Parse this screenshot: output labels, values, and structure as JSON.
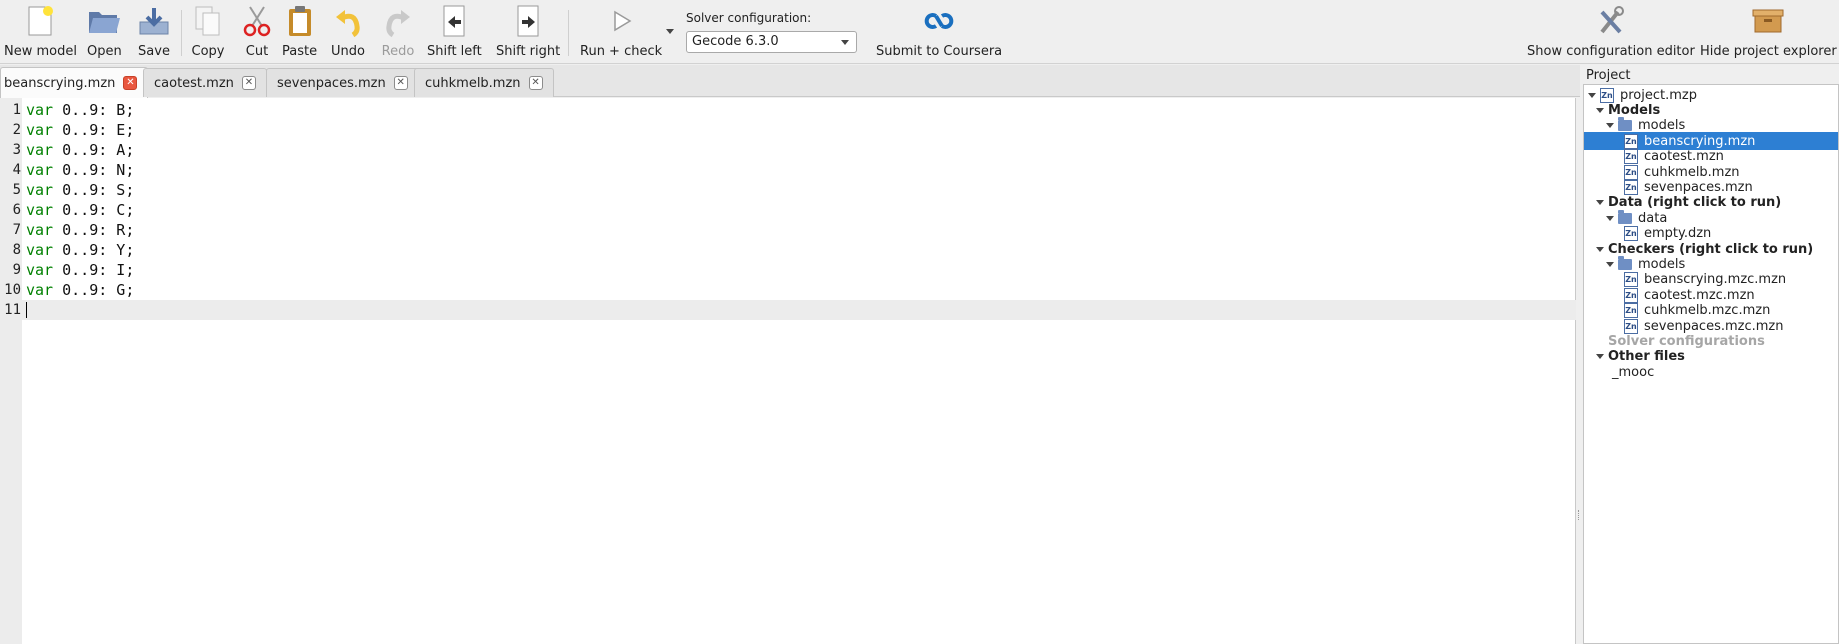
{
  "toolbar": {
    "new_model": "New model",
    "open": "Open",
    "save": "Save",
    "copy": "Copy",
    "cut": "Cut",
    "paste": "Paste",
    "undo": "Undo",
    "redo": "Redo",
    "shift_left": "Shift left",
    "shift_right": "Shift right",
    "run_check": "Run + check",
    "solver_label": "Solver configuration:",
    "solver_value": "Gecode 6.3.0",
    "submit": "Submit to Coursera",
    "show_config": "Show configuration editor",
    "hide_explorer": "Hide project explorer"
  },
  "tabs": [
    {
      "label": "beanscrying.mzn",
      "active": true
    },
    {
      "label": "caotest.mzn",
      "active": false
    },
    {
      "label": "sevenpaces.mzn",
      "active": false
    },
    {
      "label": "cuhkmelb.mzn",
      "active": false
    }
  ],
  "editor": {
    "lines": [
      {
        "num": "1",
        "kw": "var",
        "rest": " 0..9: B;"
      },
      {
        "num": "2",
        "kw": "var",
        "rest": " 0..9: E;"
      },
      {
        "num": "3",
        "kw": "var",
        "rest": " 0..9: A;"
      },
      {
        "num": "4",
        "kw": "var",
        "rest": " 0..9: N;"
      },
      {
        "num": "5",
        "kw": "var",
        "rest": " 0..9: S;"
      },
      {
        "num": "6",
        "kw": "var",
        "rest": " 0..9: C;"
      },
      {
        "num": "7",
        "kw": "var",
        "rest": " 0..9: R;"
      },
      {
        "num": "8",
        "kw": "var",
        "rest": " 0..9: Y;"
      },
      {
        "num": "9",
        "kw": "var",
        "rest": " 0..9: I;"
      },
      {
        "num": "10",
        "kw": "var",
        "rest": " 0..9: G;"
      },
      {
        "num": "11",
        "kw": "",
        "rest": ""
      }
    ]
  },
  "project": {
    "title": "Project",
    "tree": [
      {
        "label": "project.mzp",
        "type": "file",
        "indent": 0,
        "arrow": true
      },
      {
        "label": "Models",
        "type": "group",
        "indent": 1,
        "arrow": true
      },
      {
        "label": "models",
        "type": "folder",
        "indent": 2,
        "arrow": true
      },
      {
        "label": "beanscrying.mzn",
        "type": "file",
        "indent": 3,
        "selected": true
      },
      {
        "label": "caotest.mzn",
        "type": "file",
        "indent": 3
      },
      {
        "label": "cuhkmelb.mzn",
        "type": "file",
        "indent": 3
      },
      {
        "label": "sevenpaces.mzn",
        "type": "file",
        "indent": 3
      },
      {
        "label": "Data (right click to run)",
        "type": "group",
        "indent": 1,
        "arrow": true
      },
      {
        "label": "data",
        "type": "folder",
        "indent": 2,
        "arrow": true
      },
      {
        "label": "empty.dzn",
        "type": "file",
        "indent": 3
      },
      {
        "label": "Checkers (right click to run)",
        "type": "group",
        "indent": 1,
        "arrow": true
      },
      {
        "label": "models",
        "type": "folder",
        "indent": 2,
        "arrow": true
      },
      {
        "label": "beanscrying.mzc.mzn",
        "type": "file",
        "indent": 3
      },
      {
        "label": "caotest.mzc.mzn",
        "type": "file",
        "indent": 3
      },
      {
        "label": "cuhkmelb.mzc.mzn",
        "type": "file",
        "indent": 3
      },
      {
        "label": "sevenpaces.mzc.mzn",
        "type": "file",
        "indent": 3
      },
      {
        "label": "Solver configurations",
        "type": "dim",
        "indent": 1
      },
      {
        "label": "Other files",
        "type": "group",
        "indent": 1,
        "arrow": true
      },
      {
        "label": "_mooc",
        "type": "plain",
        "indent": 2
      }
    ]
  },
  "colors": {
    "keyword": "#008000",
    "selection": "#2d7fd3",
    "active_tab_close": "#e9573f"
  }
}
